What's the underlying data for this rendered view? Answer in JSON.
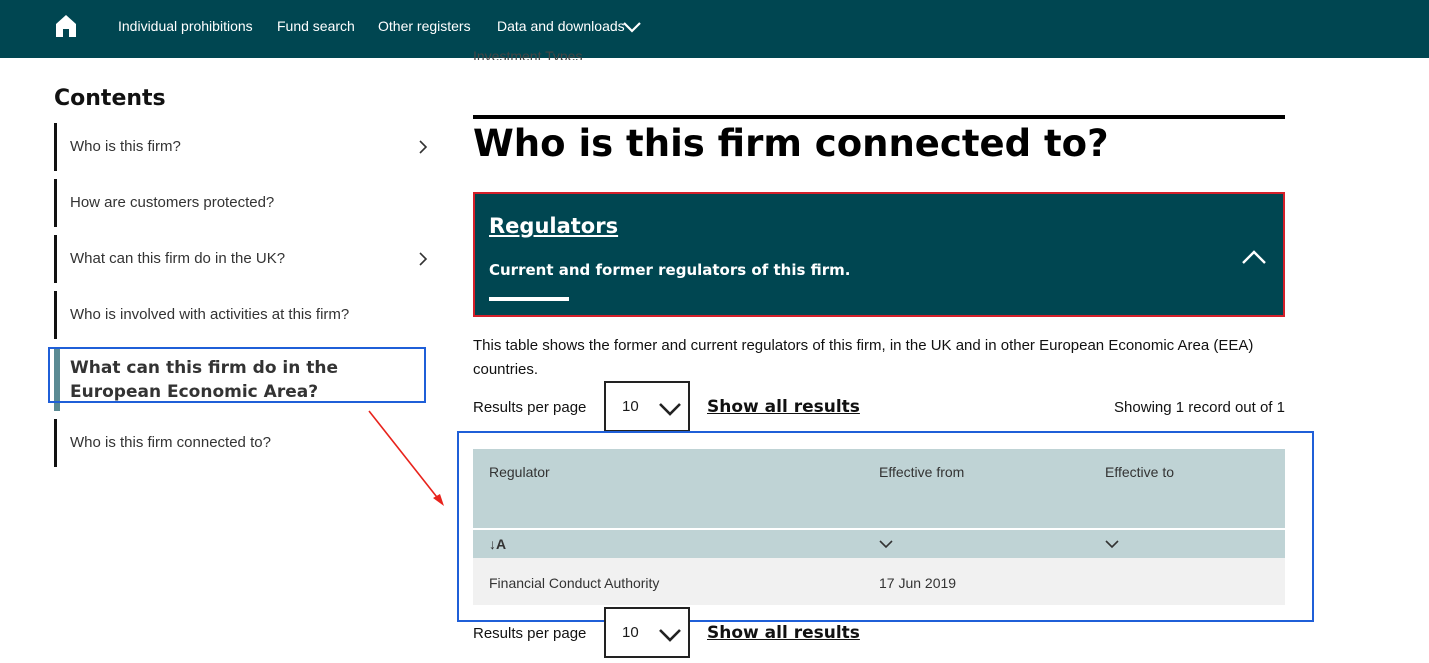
{
  "nav": {
    "items": [
      "Individual prohibitions",
      "Fund search",
      "Other registers",
      "Data and downloads"
    ]
  },
  "clipped_section_label": "Investment Types",
  "sidebar": {
    "title": "Contents",
    "items": [
      "Who is this firm?",
      "How are customers protected?",
      "What can this firm do in the UK?",
      "Who is involved with activities at this firm?",
      "What can this firm do in the European Economic Area?",
      "Who is this firm connected to?"
    ]
  },
  "main": {
    "heading": "Who is this firm connected to?",
    "regulators_panel": {
      "title": "Regulators",
      "subtitle": "Current and former regulators of this firm."
    },
    "intro": "This table shows the former and current regulators of this firm, in the UK and in other European Economic Area (EEA) countries.",
    "pagination": {
      "results_per_page_label": "Results per page",
      "results_per_page_value": "10",
      "show_all": "Show all results",
      "showing": "Showing 1 record out of 1"
    },
    "table": {
      "headers": [
        "Regulator",
        "Effective from",
        "Effective to"
      ],
      "sort_indicator": "↓A",
      "rows": [
        [
          "Financial Conduct Authority",
          "17 Jun 2019",
          ""
        ]
      ]
    }
  },
  "colors": {
    "nav_bg": "#004651",
    "panel_border": "#d4202a",
    "table_header": "#bfd3d5",
    "annotation": "#1f5fd8",
    "arrow": "#e8231c"
  }
}
